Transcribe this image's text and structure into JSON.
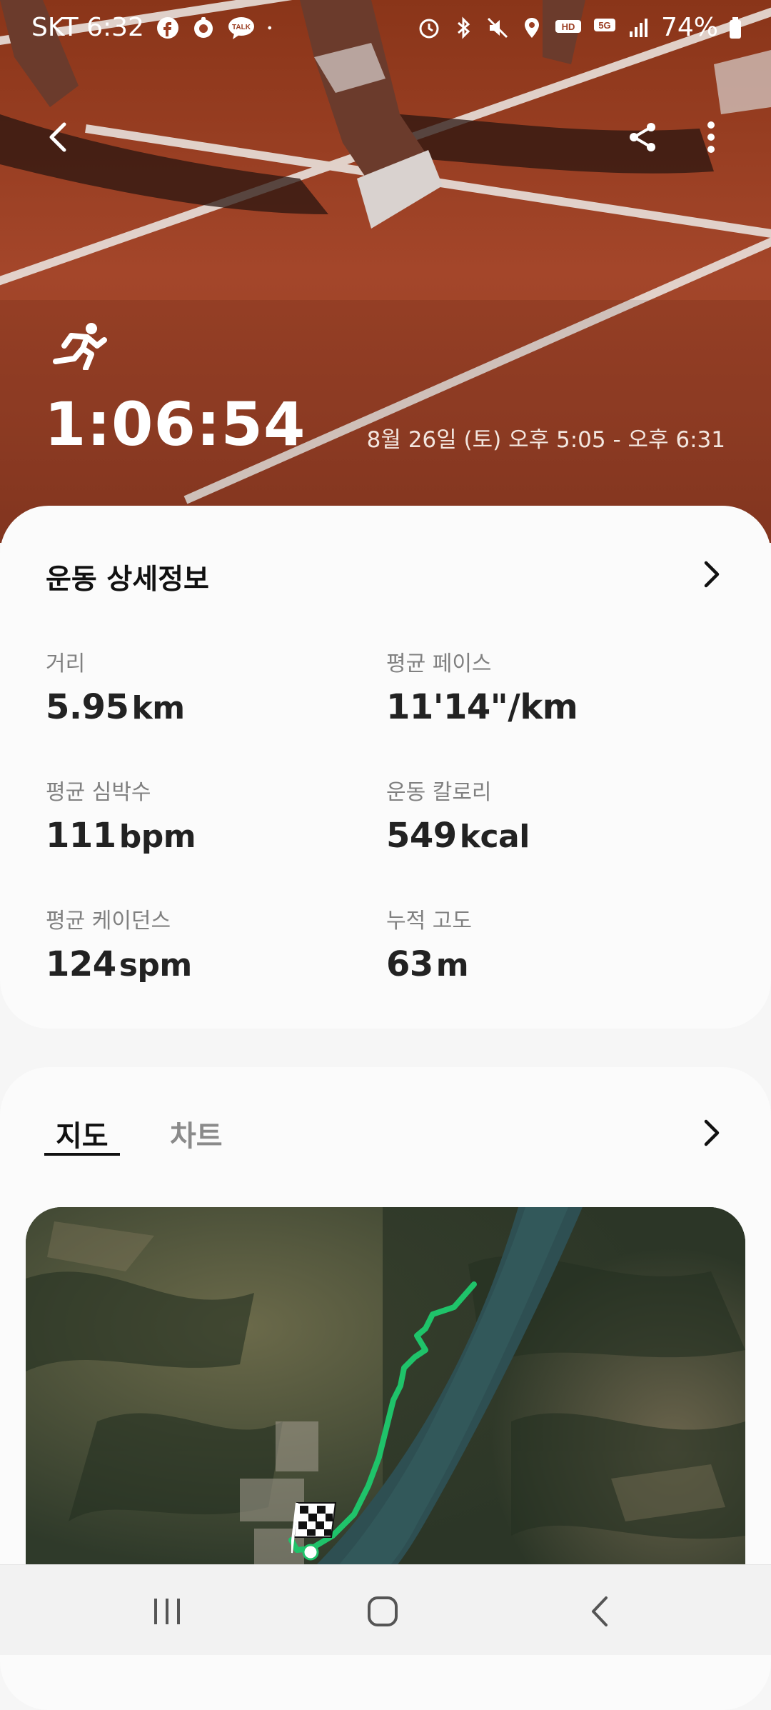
{
  "status_bar": {
    "carrier_time": "SKT 6:32",
    "battery": "74%",
    "icons_left": [
      "facebook-icon",
      "messenger-icon",
      "talk-icon",
      "dot-icon"
    ],
    "icons_right": [
      "alarm-icon",
      "bluetooth-icon",
      "mute-icon",
      "location-icon",
      "hd-voice-icon",
      "5g-icon",
      "signal-icon",
      "battery-icon"
    ],
    "talk_badge": "TALK",
    "hd_badge": "HD",
    "fiveg_badge": "5G"
  },
  "header": {
    "back_icon": "back-arrow-icon",
    "share_icon": "share-icon",
    "more_icon": "more-vertical-icon"
  },
  "workout": {
    "activity_icon": "running-icon",
    "duration": "1:06:54",
    "date_range": "8월 26일 (토) 오후 5:05 - 오후 6:31"
  },
  "details": {
    "title": "운동 상세정보",
    "metrics": [
      {
        "label": "거리",
        "value": "5.95",
        "unit": "km"
      },
      {
        "label": "평균 페이스",
        "value": "11'14\"/km",
        "unit": ""
      },
      {
        "label": "평균 심박수",
        "value": "111",
        "unit": "bpm"
      },
      {
        "label": "운동 칼로리",
        "value": "549",
        "unit": "kcal"
      },
      {
        "label": "평균 케이던스",
        "value": "124",
        "unit": "spm"
      },
      {
        "label": "누적 고도",
        "value": "63",
        "unit": "m"
      }
    ]
  },
  "tabs": {
    "map": "지도",
    "chart": "차트"
  },
  "colors": {
    "route": "#1fc36a",
    "track": "#9c3f24",
    "card": "#fbfbfb"
  },
  "navbar": {
    "recent_icon": "recent-apps-icon",
    "home_icon": "home-icon",
    "back_icon": "nav-back-icon"
  }
}
